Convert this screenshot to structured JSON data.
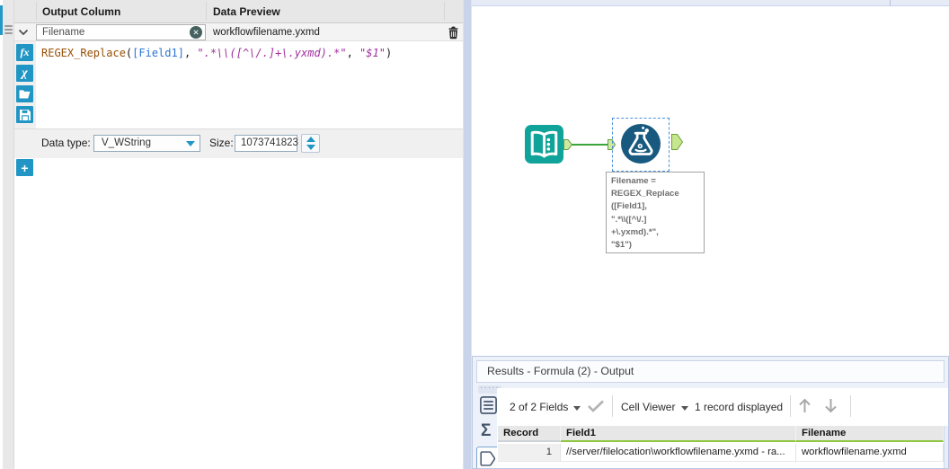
{
  "colors": {
    "accent_blue": "#2196c4",
    "input_tool_teal": "#0fa399",
    "formula_tool_blue": "#17597f",
    "connection_green": "#3aa53a",
    "anchor_green_fill": "#cfe9a0",
    "anchor_green_stroke": "#63a046",
    "selection_blue": "#4a90d9",
    "results_header_green": "#8dc63f",
    "formula_function_brown": "#975005",
    "formula_field_blue": "#2b74d9",
    "formula_string_purple": "#a0309e"
  },
  "icons": {
    "fx_button": "fx",
    "chi_button": "χ",
    "plus_button": "+",
    "clear_x": "✕",
    "sigma": "Σ",
    "grip_dots": "·····"
  },
  "config_panel": {
    "headers": {
      "output_column": "Output Column",
      "data_preview": "Data Preview"
    },
    "field_row": {
      "output_name": "Filename",
      "preview_value": "workflowfilename.yxmd"
    },
    "formula": {
      "segments": [
        {
          "text": "REGEX_Replace",
          "type": "func"
        },
        {
          "text": "(",
          "type": "plain"
        },
        {
          "text": "[Field1]",
          "type": "field"
        },
        {
          "text": ", ",
          "type": "plain"
        },
        {
          "text": "\".*\\\\([^\\/.]+\\.yxmd).*\"",
          "type": "string"
        },
        {
          "text": ", ",
          "type": "plain"
        },
        {
          "text": "\"$1\"",
          "type": "string"
        },
        {
          "text": ")",
          "type": "plain"
        }
      ]
    },
    "datatype_row": {
      "label": "Data type:",
      "value": "V_WString",
      "size_label": "Size:",
      "size_value": "1073741823"
    }
  },
  "canvas": {
    "annotation_lines": [
      "Filename =",
      "REGEX_Replace",
      "([Field1],",
      "\".*\\\\([^\\/.]",
      "+\\.yxmd).*\",",
      "\"$1\")"
    ]
  },
  "results": {
    "title": "Results - Formula (2) - Output",
    "toolbar": {
      "fields_summary": "2 of 2 Fields",
      "cell_viewer_label": "Cell Viewer",
      "record_count": "1 record displayed"
    },
    "table": {
      "headers": [
        "Record",
        "Field1",
        "Filename"
      ],
      "rows": [
        [
          "1",
          "//server/filelocation\\workflowfilename.yxmd - ra...",
          "workflowfilename.yxmd"
        ]
      ]
    }
  }
}
